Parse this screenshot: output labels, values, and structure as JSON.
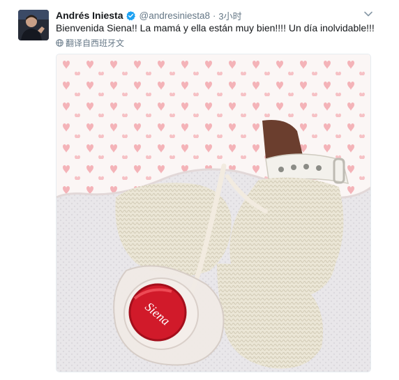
{
  "tweet": {
    "author_name": "Andrés Iniesta",
    "handle": "@andresiniesta8",
    "separator": "·",
    "time": "3小时",
    "text": "Bienvenida Siena!! La mamá y ella están muy bien!!!! Un día inolvidable!!!",
    "translate_label": "翻译自西班牙文",
    "photo": {
      "pacifier_text": "Siena"
    }
  },
  "icons": {
    "verified": "verified-badge-icon",
    "caret": "chevron-down-icon",
    "translate": "globe-icon"
  },
  "colors": {
    "verified": "#1da1f2",
    "muted": "#657786",
    "text": "#14171a",
    "pacifier_red": "#d11a2a",
    "hearts": "#f4b3b8"
  }
}
